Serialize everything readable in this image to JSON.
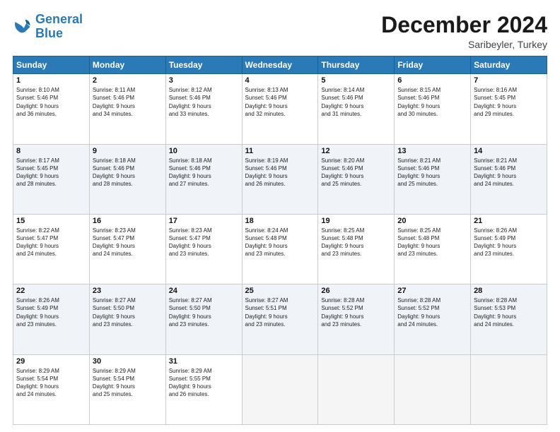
{
  "logo": {
    "line1": "General",
    "line2": "Blue"
  },
  "title": "December 2024",
  "subtitle": "Saribeyler, Turkey",
  "days_of_week": [
    "Sunday",
    "Monday",
    "Tuesday",
    "Wednesday",
    "Thursday",
    "Friday",
    "Saturday"
  ],
  "weeks": [
    [
      {
        "day": "1",
        "text": "Sunrise: 8:10 AM\nSunset: 5:46 PM\nDaylight: 9 hours\nand 36 minutes."
      },
      {
        "day": "2",
        "text": "Sunrise: 8:11 AM\nSunset: 5:46 PM\nDaylight: 9 hours\nand 34 minutes."
      },
      {
        "day": "3",
        "text": "Sunrise: 8:12 AM\nSunset: 5:46 PM\nDaylight: 9 hours\nand 33 minutes."
      },
      {
        "day": "4",
        "text": "Sunrise: 8:13 AM\nSunset: 5:46 PM\nDaylight: 9 hours\nand 32 minutes."
      },
      {
        "day": "5",
        "text": "Sunrise: 8:14 AM\nSunset: 5:46 PM\nDaylight: 9 hours\nand 31 minutes."
      },
      {
        "day": "6",
        "text": "Sunrise: 8:15 AM\nSunset: 5:46 PM\nDaylight: 9 hours\nand 30 minutes."
      },
      {
        "day": "7",
        "text": "Sunrise: 8:16 AM\nSunset: 5:45 PM\nDaylight: 9 hours\nand 29 minutes."
      }
    ],
    [
      {
        "day": "8",
        "text": "Sunrise: 8:17 AM\nSunset: 5:45 PM\nDaylight: 9 hours\nand 28 minutes."
      },
      {
        "day": "9",
        "text": "Sunrise: 8:18 AM\nSunset: 5:46 PM\nDaylight: 9 hours\nand 28 minutes."
      },
      {
        "day": "10",
        "text": "Sunrise: 8:18 AM\nSunset: 5:46 PM\nDaylight: 9 hours\nand 27 minutes."
      },
      {
        "day": "11",
        "text": "Sunrise: 8:19 AM\nSunset: 5:46 PM\nDaylight: 9 hours\nand 26 minutes."
      },
      {
        "day": "12",
        "text": "Sunrise: 8:20 AM\nSunset: 5:46 PM\nDaylight: 9 hours\nand 25 minutes."
      },
      {
        "day": "13",
        "text": "Sunrise: 8:21 AM\nSunset: 5:46 PM\nDaylight: 9 hours\nand 25 minutes."
      },
      {
        "day": "14",
        "text": "Sunrise: 8:21 AM\nSunset: 5:46 PM\nDaylight: 9 hours\nand 24 minutes."
      }
    ],
    [
      {
        "day": "15",
        "text": "Sunrise: 8:22 AM\nSunset: 5:47 PM\nDaylight: 9 hours\nand 24 minutes."
      },
      {
        "day": "16",
        "text": "Sunrise: 8:23 AM\nSunset: 5:47 PM\nDaylight: 9 hours\nand 24 minutes."
      },
      {
        "day": "17",
        "text": "Sunrise: 8:23 AM\nSunset: 5:47 PM\nDaylight: 9 hours\nand 23 minutes."
      },
      {
        "day": "18",
        "text": "Sunrise: 8:24 AM\nSunset: 5:48 PM\nDaylight: 9 hours\nand 23 minutes."
      },
      {
        "day": "19",
        "text": "Sunrise: 8:25 AM\nSunset: 5:48 PM\nDaylight: 9 hours\nand 23 minutes."
      },
      {
        "day": "20",
        "text": "Sunrise: 8:25 AM\nSunset: 5:48 PM\nDaylight: 9 hours\nand 23 minutes."
      },
      {
        "day": "21",
        "text": "Sunrise: 8:26 AM\nSunset: 5:49 PM\nDaylight: 9 hours\nand 23 minutes."
      }
    ],
    [
      {
        "day": "22",
        "text": "Sunrise: 8:26 AM\nSunset: 5:49 PM\nDaylight: 9 hours\nand 23 minutes."
      },
      {
        "day": "23",
        "text": "Sunrise: 8:27 AM\nSunset: 5:50 PM\nDaylight: 9 hours\nand 23 minutes."
      },
      {
        "day": "24",
        "text": "Sunrise: 8:27 AM\nSunset: 5:50 PM\nDaylight: 9 hours\nand 23 minutes."
      },
      {
        "day": "25",
        "text": "Sunrise: 8:27 AM\nSunset: 5:51 PM\nDaylight: 9 hours\nand 23 minutes."
      },
      {
        "day": "26",
        "text": "Sunrise: 8:28 AM\nSunset: 5:52 PM\nDaylight: 9 hours\nand 23 minutes."
      },
      {
        "day": "27",
        "text": "Sunrise: 8:28 AM\nSunset: 5:52 PM\nDaylight: 9 hours\nand 24 minutes."
      },
      {
        "day": "28",
        "text": "Sunrise: 8:28 AM\nSunset: 5:53 PM\nDaylight: 9 hours\nand 24 minutes."
      }
    ],
    [
      {
        "day": "29",
        "text": "Sunrise: 8:29 AM\nSunset: 5:54 PM\nDaylight: 9 hours\nand 24 minutes."
      },
      {
        "day": "30",
        "text": "Sunrise: 8:29 AM\nSunset: 5:54 PM\nDaylight: 9 hours\nand 25 minutes."
      },
      {
        "day": "31",
        "text": "Sunrise: 8:29 AM\nSunset: 5:55 PM\nDaylight: 9 hours\nand 26 minutes."
      },
      null,
      null,
      null,
      null
    ]
  ]
}
